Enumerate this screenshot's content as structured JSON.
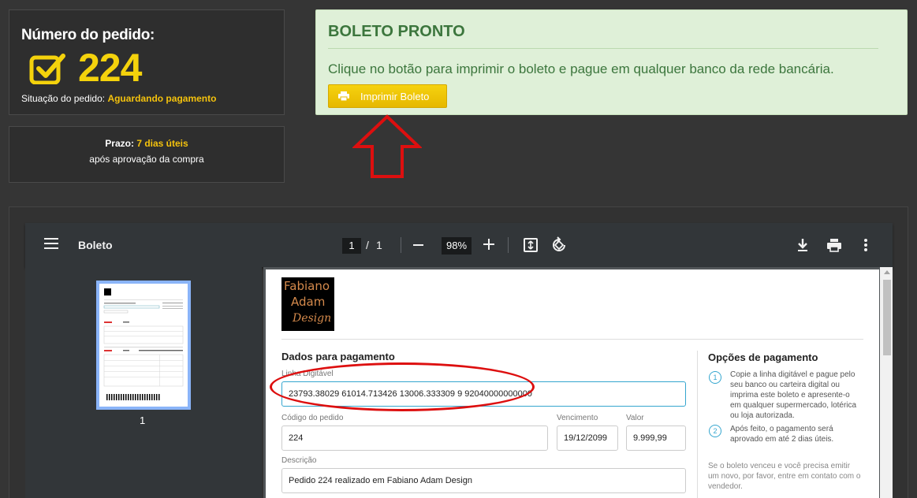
{
  "order": {
    "title": "Número do pedido:",
    "number": "224",
    "status_label": "Situação do pedido:",
    "status_value": "Aguardando pagamento"
  },
  "deadline": {
    "label": "Prazo:",
    "value": "7 dias úteis",
    "note": "após aprovação da compra"
  },
  "ready": {
    "title": "BOLETO PRONTO",
    "message": "Clique no botão para imprimir o boleto e pague em qualquer banco da rede bancária.",
    "button_label": "Imprimir Boleto"
  },
  "pdf_viewer": {
    "title": "Boleto",
    "current_page": "1",
    "page_separator": "/",
    "total_pages": "1",
    "zoom": "98%",
    "thumbnail_label": "1"
  },
  "boleto": {
    "logo": {
      "line1": "Fabiano",
      "line2": "Adam",
      "line3": "Design"
    },
    "section_title": "Dados para pagamento",
    "linha_label": "Linha Digitável",
    "linha_value": "23793.38029 61014.713426 13006.333309 9 92040000000000",
    "codigo_label": "Código do pedido",
    "codigo_value": "224",
    "vencimento_label": "Vencimento",
    "vencimento_value": "19/12/2099",
    "valor_label": "Valor",
    "valor_value": "9.999,99",
    "descricao_label": "Descrição",
    "descricao_value": "Pedido 224 realizado em Fabiano Adam Design",
    "options_title": "Opções de pagamento",
    "option1_num": "1",
    "option1_text": "Copie a linha digitável e pague pelo seu banco ou carteira digital ou imprima este boleto e apresente-o em qualquer supermercado, lotérica ou loja autorizada.",
    "option2_num": "2",
    "option2_text": "Após feito, o pagamento será aprovado em até 2 dias úteis.",
    "note": "Se o boleto venceu e você precisa emitir um novo, por favor, entre em contato com o vendedor."
  },
  "colors": {
    "accent_yellow": "#f4d20c",
    "success_bg": "#dff0d8",
    "success_text": "#3c763d",
    "annotation_red": "#dd0f0f"
  }
}
